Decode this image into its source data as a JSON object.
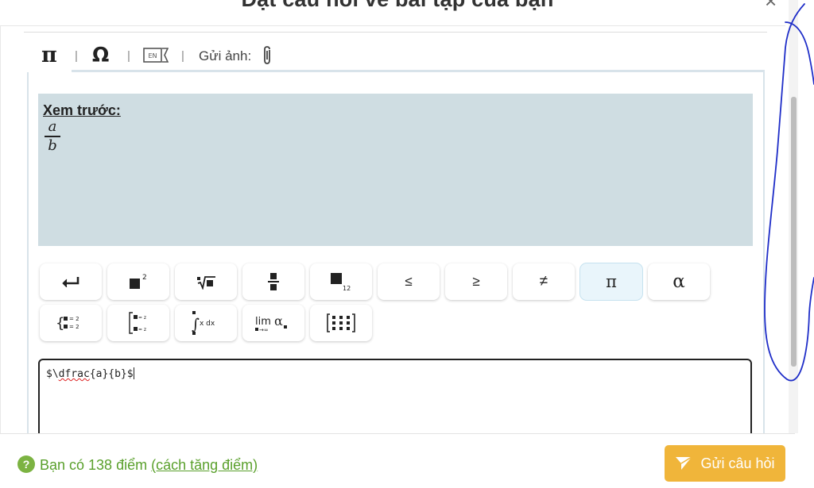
{
  "modal": {
    "title": "Đặt câu hỏi về bài tập của bạn",
    "close_symbol": "×"
  },
  "toolbar": {
    "math_tab_symbol": "π",
    "separator": "|",
    "symbols_tab_symbol": "Ω",
    "upload_label": "Gửi ảnh:",
    "lang_icon": "english-keyboard-icon",
    "lang_text": "EN",
    "upload_icon": "paperclip-icon"
  },
  "preview": {
    "label": "Xem trước:",
    "numerator": "a",
    "denominator": "b"
  },
  "keyboard": {
    "row1": [
      {
        "id": "enter",
        "icon": "enter-icon"
      },
      {
        "id": "power",
        "icon": "superscript-icon",
        "text": "2"
      },
      {
        "id": "root",
        "icon": "nth-root-icon"
      },
      {
        "id": "fraction",
        "icon": "fraction-icon"
      },
      {
        "id": "subscript",
        "icon": "subscript-icon",
        "text": "12"
      },
      {
        "id": "leq",
        "text": "≤"
      },
      {
        "id": "geq",
        "text": "≥"
      },
      {
        "id": "neq",
        "text": "≠"
      },
      {
        "id": "pi",
        "text": "π",
        "active": true
      },
      {
        "id": "alpha",
        "text": "α"
      }
    ],
    "row2": [
      {
        "id": "system",
        "icon": "equation-system-icon",
        "text": "= 2"
      },
      {
        "id": "bracket",
        "icon": "bracket-system-icon",
        "text": "= z"
      },
      {
        "id": "integral",
        "icon": "integral-icon",
        "text": "x dx"
      },
      {
        "id": "limit",
        "icon": "limit-icon",
        "text": "lim",
        "sub": "→∞",
        "greek": "α"
      },
      {
        "id": "matrix",
        "icon": "matrix-icon"
      }
    ]
  },
  "editor": {
    "value_prefix": "$\\",
    "value_spell": "dfrac",
    "value_suffix": "{a}{b}$"
  },
  "footer": {
    "help_symbol": "?",
    "points_text": "Bạn có 138 điểm",
    "points_link": "(cách tăng điểm)",
    "submit_label": "Gửi câu hỏi",
    "submit_icon": "send-icon"
  },
  "colors": {
    "preview_bg": "#cfdde2",
    "green": "#5aa02c",
    "submit_bg": "#f0b53a",
    "annotation": "#1f2ec8"
  }
}
